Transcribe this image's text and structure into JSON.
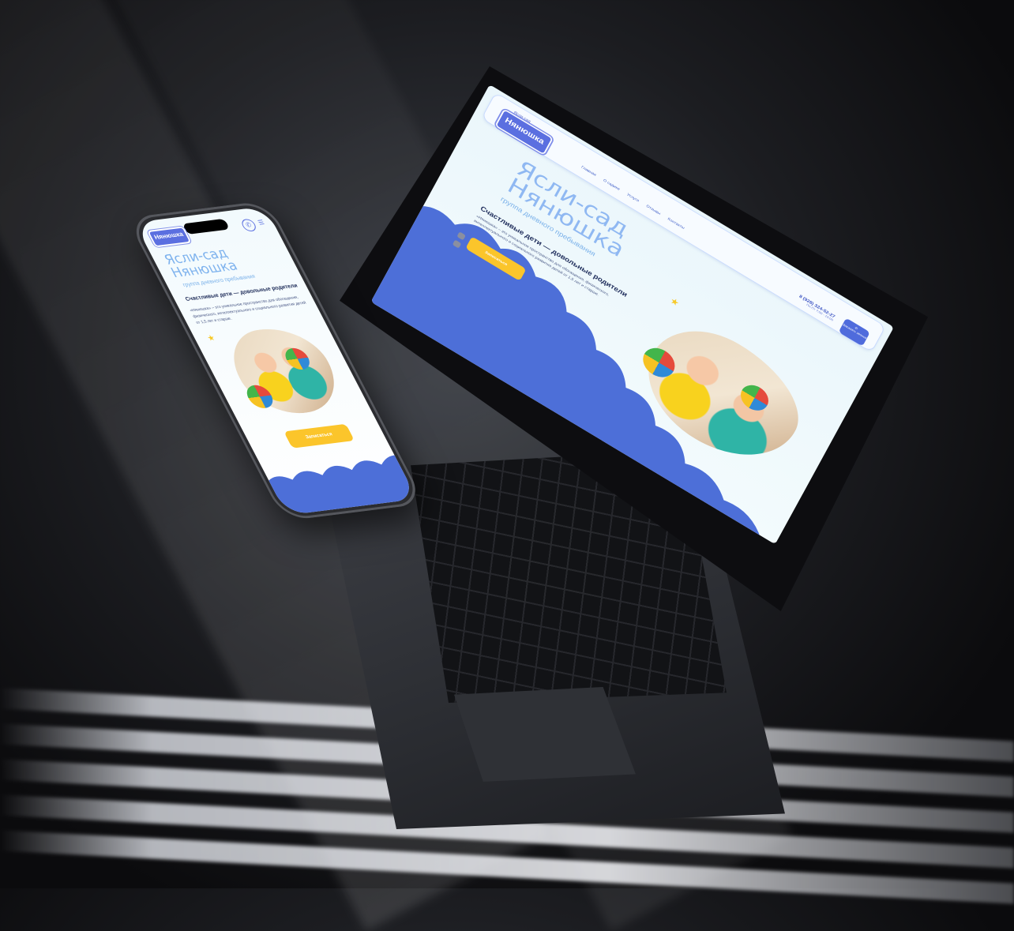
{
  "site": {
    "logo_text": "Нянюшка",
    "logo_caption": "Ясли-сад",
    "nav": [
      "Главная",
      "О садике",
      "Услуги",
      "Отзывы",
      "Контакты"
    ],
    "phone": "8 (928) 324-52-27",
    "hours": "Пн-Пт 7:00 - 19:00",
    "call_button": "Заказать звонок",
    "title_line1": "Ясли-сад",
    "title_line2": "Нянюшка",
    "subtitle": "группа дневного пребывания",
    "slogan": "Счастливые дети — довольные родители",
    "description": "«Нянюшка» – это уникальное пространство для обогащения, физического, интеллектуального и социального развития детей от 1,5 лет и старше.",
    "cta_button": "Записаться"
  },
  "icons": [
    "phone-icon",
    "menu-icon",
    "odnoklassniki-icon",
    "instagram-icon",
    "star-icon"
  ],
  "colors": {
    "brand_blue": "#4f6bdc",
    "title_blue": "#8fb8f2",
    "accent_yellow": "#fbc52b",
    "dark_text": "#22305e"
  }
}
